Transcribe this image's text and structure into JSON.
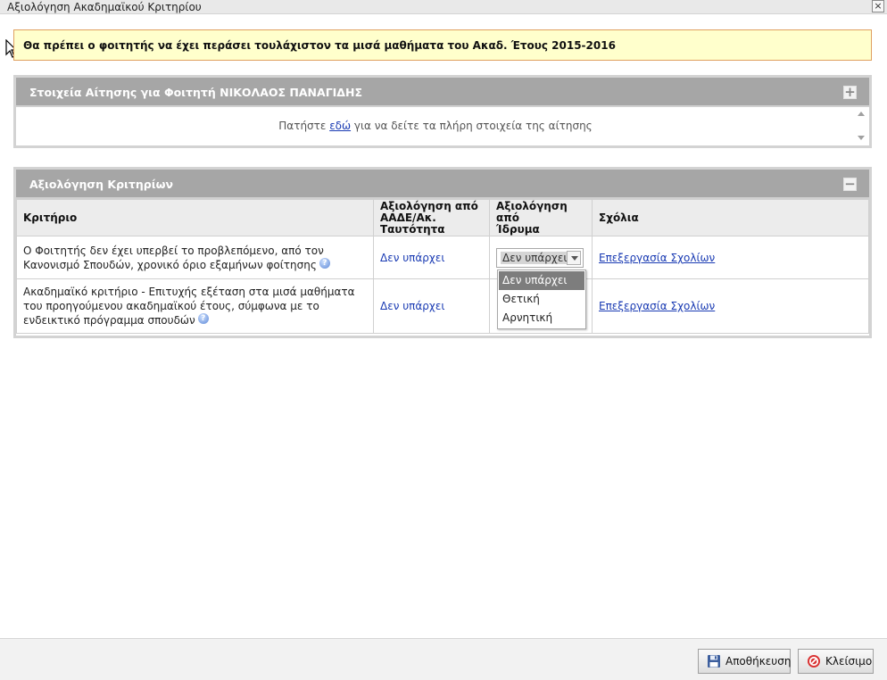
{
  "window": {
    "title": "Αξιολόγηση Ακαδημαϊκού Κριτηρίου"
  },
  "warning": {
    "text": "Θα πρέπει ο φοιτητής να έχει περάσει τουλάχιστον τα μισά μαθήματα του Ακαδ. Έτους 2015-2016"
  },
  "application_panel": {
    "title": "Στοιχεία Αίτησης για Φοιτητή ΝΙΚΟΛΑΟΣ ΠΑΝΑΓΙΔΗΣ",
    "text_before": "Πατήστε ",
    "link": "εδώ",
    "text_after": " για να δείτε τα πλήρη στοιχεία της αίτησης",
    "toggle": "+"
  },
  "criteria_panel": {
    "title": "Αξιολόγηση Κριτηρίων",
    "toggle": "−",
    "columns": {
      "criterion": "Κριτήριο",
      "aade_line1": "Αξιολόγηση από",
      "aade_line2": "ΑΑΔΕ/Ακ. Ταυτότητα",
      "institution_line1": "Αξιολόγηση από",
      "institution_line2": "Ίδρυμα",
      "comments": "Σχόλια"
    },
    "rows": [
      {
        "criterion": "Ο Φοιτητής δεν έχει υπερβεί το προβλεπόμενο, από τον Κανονισμό Σπουδών, χρονικό όριο εξαμήνων φοίτησης",
        "aade": "Δεν υπάρχει",
        "institution": "Δεν υπάρχει",
        "comments": "Επεξεργασία Σχολίων"
      },
      {
        "criterion": "Ακαδημαϊκό κριτήριο - Επιτυχής εξέταση στα μισά μαθήματα του προηγούμενου ακαδημαϊκού έτους, σύμφωνα με το ενδεικτικό πρόγραμμα σπουδών",
        "aade": "Δεν υπάρχει",
        "comments": "Επεξεργασία Σχολίων"
      }
    ],
    "dropdown_options": [
      "Δεν υπάρχει",
      "Θετική",
      "Αρνητική"
    ]
  },
  "footer": {
    "save": "Αποθήκευση",
    "close": "Κλείσιμο"
  },
  "icons": {
    "help": "help-icon",
    "save": "floppy-disk-icon",
    "close": "cancel-icon"
  },
  "colors": {
    "warning_bg": "#ffffcc",
    "header_bg": "#a6a6a6",
    "link": "#1a3bb3",
    "selected_option_bg": "#7d7d7d"
  }
}
